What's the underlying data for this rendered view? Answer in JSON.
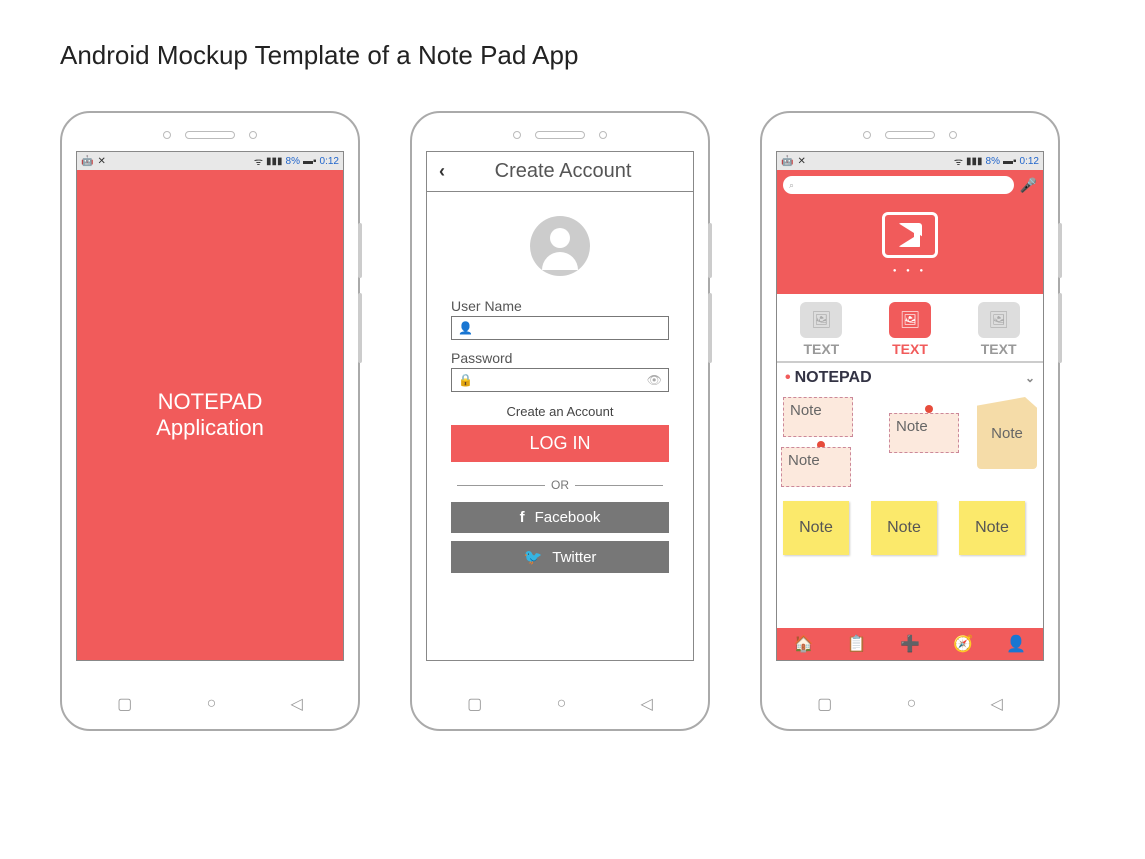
{
  "page": {
    "title": "Android Mockup Template of a Note Pad App"
  },
  "splash": {
    "line1": "NOTEPAD",
    "line2": "Application"
  },
  "statusBar": {
    "battery": "8%",
    "time": "0:12",
    "battery3": "8%",
    "time3": "0:12"
  },
  "createAccount": {
    "title": "Create Account",
    "usernameLabel": "User Name",
    "passwordLabel": "Password",
    "createLink": "Create an Account",
    "loginBtn": "LOG IN",
    "or": "OR",
    "facebook": "Facebook",
    "twitter": "Twitter"
  },
  "tabs": {
    "t1": "TEXT",
    "t2": "TEXT",
    "t3": "TEXT"
  },
  "section": {
    "title": "NOTEPAD"
  },
  "notes": {
    "n1": "Note",
    "n2": "Note",
    "n3": "Note",
    "n4": "Note",
    "s1": "Note",
    "s2": "Note",
    "s3": "Note"
  }
}
